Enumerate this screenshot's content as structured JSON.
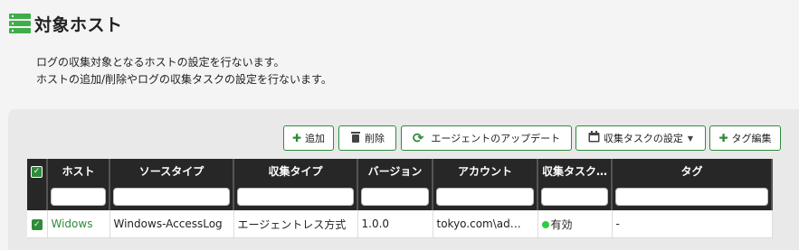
{
  "page": {
    "title": "対象ホスト",
    "description_line1": "ログの収集対象となるホストの設定を行ないます。",
    "description_line2": "ホストの追加/削除やログの収集タスクの設定を行ないます。"
  },
  "toolbar": {
    "add_label": "追加",
    "delete_label": "削除",
    "agent_update_label": "エージェントのアップデート",
    "task_settings_label": "収集タスクの設定",
    "tag_edit_label": "タグ編集"
  },
  "icons": {
    "title": "server-list-icon",
    "add": "plus-icon",
    "delete": "trash-icon",
    "update": "refresh-icon",
    "task": "calendar-icon",
    "tag": "plus-icon"
  },
  "colors": {
    "accent": "#2e8b3a",
    "header_bg": "#272727",
    "status_on": "#2ecc40"
  },
  "table": {
    "columns": [
      "ホスト",
      "ソースタイプ",
      "収集タイプ",
      "バージョン",
      "アカウント",
      "収集タスク…",
      "タグ"
    ],
    "rows": [
      {
        "host": "Widows",
        "source_type": "Windows-AccessLog",
        "collect_type": "エージェントレス方式",
        "version": "1.0.0",
        "account": "tokyo.com\\ad…",
        "task_status": "有効",
        "tag": "-"
      }
    ]
  }
}
